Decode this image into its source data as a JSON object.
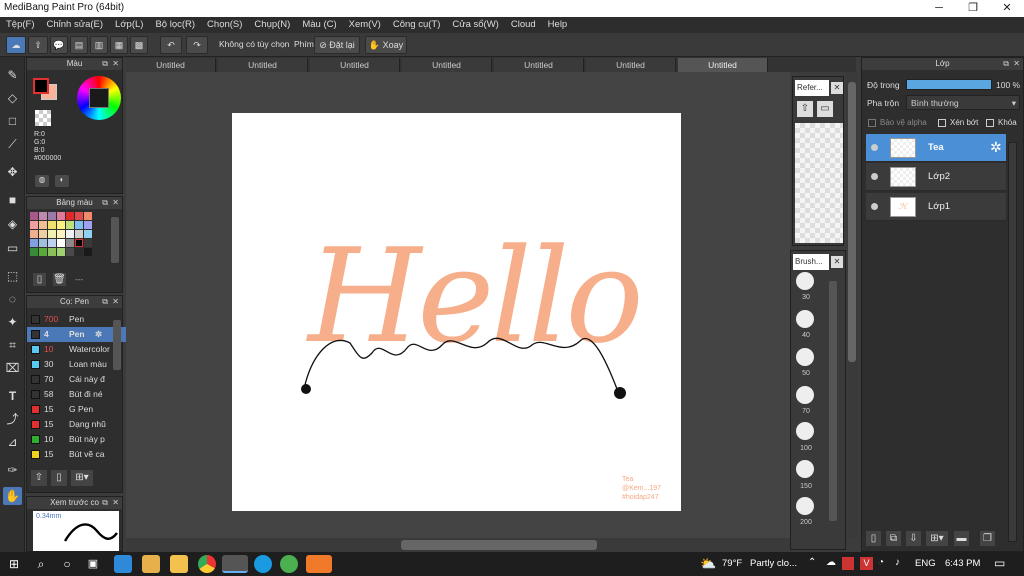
{
  "window": {
    "title": "MediBang Paint Pro (64bit)",
    "minimize": "─",
    "maximize": "❐",
    "close": "✕"
  },
  "menu": [
    "Tệp(F)",
    "Chỉnh sửa(E)",
    "Lớp(L)",
    "Bộ lọc(R)",
    "Chọn(S)",
    "Chụp(N)",
    "Màu (C)",
    "Xem(V)",
    "Công cụ(T)",
    "Cửa sổ(W)",
    "Cloud",
    "Help"
  ],
  "toolbar": {
    "no_selection": "Không có tùy chọn",
    "phim": "Phím",
    "reset": "Đặt lại",
    "rotate": "Xoay"
  },
  "tabs": [
    "Untitled",
    "Untitled",
    "Untitled",
    "Untitled",
    "Untitled",
    "Untitled",
    "Untitled"
  ],
  "color_panel": {
    "title": "Màu",
    "r": "R:0",
    "g": "G:0",
    "b": "B:0",
    "hex": "#000000"
  },
  "palette_panel": {
    "title": "Bảng màu",
    "dash": "---"
  },
  "brush_panel": {
    "title": "Cọ: Pen",
    "items": [
      {
        "size": "700",
        "name": "Pen",
        "color": "#333333"
      },
      {
        "size": "4",
        "name": "Pen",
        "color": "#333333"
      },
      {
        "size": "10",
        "name": "Watercolor",
        "color": "#5bc8f0"
      },
      {
        "size": "30",
        "name": "Loan màu",
        "color": "#5bc8f0"
      },
      {
        "size": "70",
        "name": "Cái này đ",
        "color": "#333333"
      },
      {
        "size": "58",
        "name": "Bút đi né",
        "color": "#333333"
      },
      {
        "size": "15",
        "name": "G Pen",
        "color": "#e03030"
      },
      {
        "size": "15",
        "name": "Dạng nhũ",
        "color": "#e03030"
      },
      {
        "size": "10",
        "name": "Bút này p",
        "color": "#2fae2f"
      },
      {
        "size": "15",
        "name": "Bút vẽ ca",
        "color": "#f0d020"
      }
    ]
  },
  "preview_panel": {
    "title": "Xem trước co",
    "size": "0.34mm"
  },
  "reference_panel": {
    "title": "Refer..."
  },
  "brush_size_panel": {
    "title": "Brush...",
    "sizes": [
      "30",
      "40",
      "50",
      "70",
      "100",
      "150",
      "200"
    ]
  },
  "layer_panel": {
    "title": "Lớp",
    "opacity_label": "Độ trong",
    "opacity_value": "100 %",
    "blend_label": "Pha trộn",
    "blend_value": "Bình thường",
    "protect_alpha": "Bảo vệ alpha",
    "clipping": "Xén bớt",
    "lock": "Khóa",
    "layers": [
      {
        "name": "Tea",
        "selected": true
      },
      {
        "name": "Lớp2",
        "selected": false
      },
      {
        "name": "Lớp1",
        "selected": false
      }
    ]
  },
  "canvas": {
    "text": "Hello",
    "watermark": [
      "Tea",
      "@Kem...197",
      "#hoidap247"
    ],
    "accent": "#f6a882"
  },
  "taskbar": {
    "weather_temp": "79°F",
    "weather_text": "Partly clo...",
    "lang": "ENG",
    "time": "6:43 PM"
  }
}
